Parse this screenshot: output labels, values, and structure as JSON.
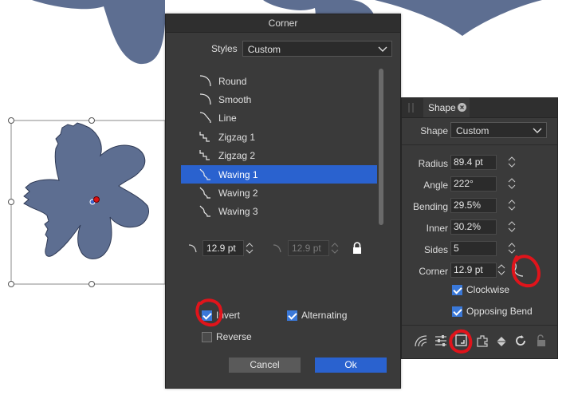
{
  "dialog": {
    "title": "Corner",
    "styles_label": "Styles",
    "styles_value": "Custom",
    "items": [
      {
        "label": "Round",
        "icon": "round-corner-icon",
        "selected": false
      },
      {
        "label": "Smooth",
        "icon": "smooth-corner-icon",
        "selected": false
      },
      {
        "label": "Line",
        "icon": "line-corner-icon",
        "selected": false
      },
      {
        "label": "Zigzag 1",
        "icon": "zigzag-corner-icon",
        "selected": false
      },
      {
        "label": "Zigzag 2",
        "icon": "zigzag-corner-icon",
        "selected": false
      },
      {
        "label": "Waving 1",
        "icon": "waving-corner-icon",
        "selected": true
      },
      {
        "label": "Waving 2",
        "icon": "waving-corner-icon",
        "selected": false
      },
      {
        "label": "Waving 3",
        "icon": "waving-corner-icon",
        "selected": false
      }
    ],
    "size_value": "12.9 pt",
    "size2_value": "12.9 pt",
    "invert_label": "Invert",
    "invert_checked": true,
    "alternating_label": "Alternating",
    "alternating_checked": true,
    "reverse_label": "Reverse",
    "reverse_checked": false,
    "cancel_label": "Cancel",
    "ok_label": "Ok"
  },
  "panel": {
    "tab_label": "Shape",
    "shape_label": "Shape",
    "shape_value": "Custom",
    "radius_label": "Radius",
    "radius_value": "89.4 pt",
    "angle_label": "Angle",
    "angle_value": "222°",
    "bending_label": "Bending",
    "bending_value": "29.5%",
    "inner_label": "Inner",
    "inner_value": "30.2%",
    "sides_label": "Sides",
    "sides_value": "5",
    "corner_label": "Corner",
    "corner_value": "12.9 pt",
    "clockwise_label": "Clockwise",
    "clockwise_checked": true,
    "opposing_label": "Opposing Bend",
    "opposing_checked": true
  },
  "colors": {
    "shape_fill": "#5d6e91",
    "dialog_bg": "#3a3a3a",
    "accent": "#2a62cf",
    "annotation": "#e0141b"
  }
}
